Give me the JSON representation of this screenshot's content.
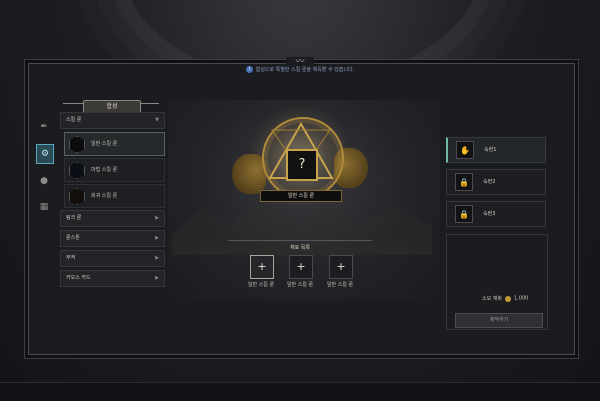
{
  "notice": {
    "icon": "info-icon",
    "text": "합성으로 특별한 스킬 룬을 획득할 수 있습니다."
  },
  "left": {
    "title": "합성",
    "side_tabs": [
      {
        "icon": "feather-icon"
      },
      {
        "icon": "gear-icon"
      },
      {
        "icon": "orb-icon"
      },
      {
        "icon": "card-stack-icon"
      }
    ],
    "categories": [
      {
        "label": "스킬 룬",
        "expanded": true,
        "subs": [
          {
            "label": "일반 스킬 룬"
          },
          {
            "label": "마법 스킬 룬"
          },
          {
            "label": "희귀 스킬 룬"
          }
        ]
      },
      {
        "label": "링크 룬"
      },
      {
        "label": "룬스톤"
      },
      {
        "label": "부적"
      },
      {
        "label": "카오스 카드"
      }
    ]
  },
  "center": {
    "result_symbol": "?",
    "result_name": "일반 스킬 룬",
    "materials_title": "재료 목록",
    "materials": [
      {
        "symbol": "+",
        "label": "일반 스킬 룬"
      },
      {
        "symbol": "+",
        "label": "일반 스킬 룬"
      },
      {
        "symbol": "+",
        "label": "일반 스킬 룬"
      }
    ]
  },
  "right": {
    "proficiency": [
      {
        "label": "숙련1",
        "icon": "hand-icon"
      },
      {
        "label": "숙련2",
        "icon": "lock-icon"
      },
      {
        "label": "숙련3",
        "icon": "lock-icon"
      }
    ],
    "owned_label": "소모 재화",
    "owned_amount": "1,000",
    "craft_label": "제작하기"
  },
  "colors": {
    "gold": "#c9a24c",
    "accent_teal": "#5aa8bf",
    "bg": "#15161a"
  }
}
